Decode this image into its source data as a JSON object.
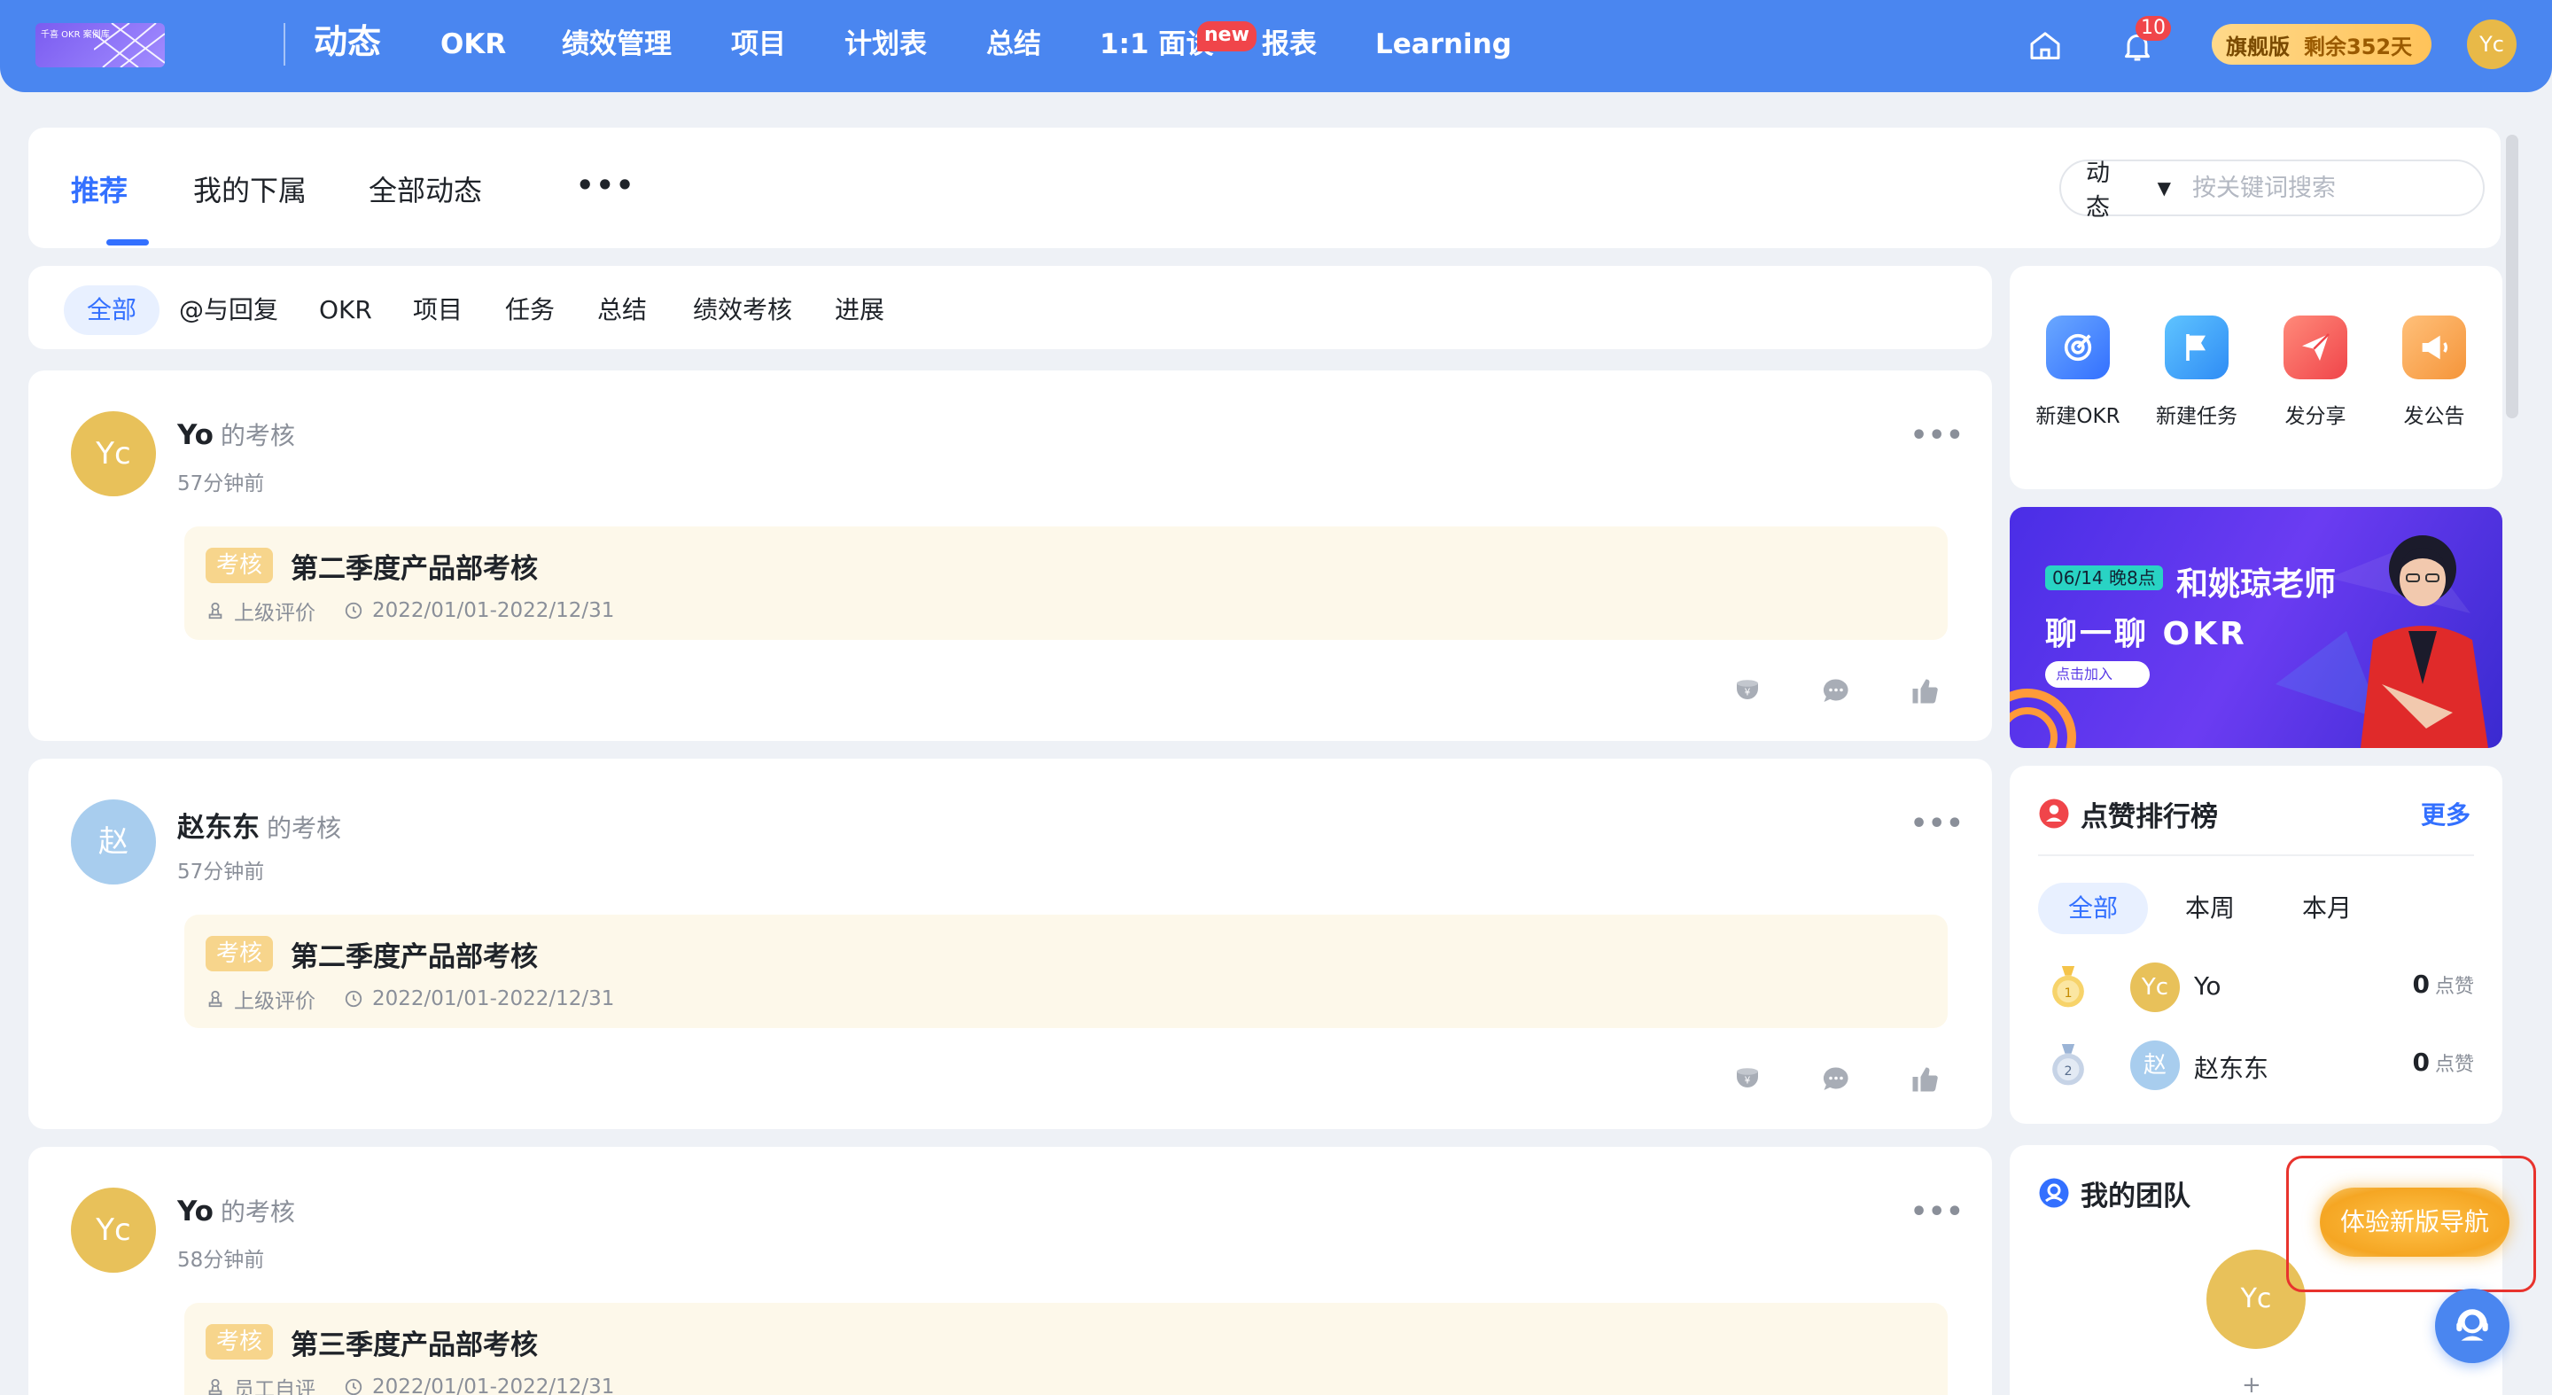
{
  "brand": {
    "logo_text": "千喜 OKR 案例库"
  },
  "nav": {
    "items": [
      "动态",
      "OKR",
      "绩效管理",
      "项目",
      "计划表",
      "总结",
      "1:1 面谈",
      "报表",
      "Learning"
    ],
    "new_badge": "new",
    "notification_count": "10",
    "plan_name": "旗舰版",
    "plan_remaining": "剩余352天",
    "avatar": "Yc"
  },
  "main_tabs": {
    "items": [
      "推荐",
      "我的下属",
      "全部动态"
    ],
    "more": "•••",
    "search_type": "动态",
    "search_placeholder": "按关键词搜索"
  },
  "filters": [
    "全部",
    "@与回复",
    "OKR",
    "项目",
    "任务",
    "总结",
    "绩效考核",
    "进展"
  ],
  "feed": [
    {
      "avatar": "Yc",
      "name": "Yo",
      "action": "的考核",
      "time": "57分钟前",
      "tag": "考核",
      "title": "第二季度产品部考核",
      "reviewer": "上级评价",
      "period": "2022/01/01-2022/12/31"
    },
    {
      "avatar": "赵",
      "name": "赵东东",
      "action": "的考核",
      "time": "57分钟前",
      "tag": "考核",
      "title": "第二季度产品部考核",
      "reviewer": "上级评价",
      "period": "2022/01/01-2022/12/31"
    },
    {
      "avatar": "Yc",
      "name": "Yo",
      "action": "的考核",
      "time": "58分钟前",
      "tag": "考核",
      "title": "第三季度产品部考核",
      "reviewer": "员工自评",
      "period": "2022/01/01-2022/12/31"
    }
  ],
  "quick_actions": [
    "新建OKR",
    "新建任务",
    "发分享",
    "发公告"
  ],
  "banner": {
    "date": "06/14 晚8点",
    "line1": "和姚琼老师",
    "line2": "聊一聊 OKR",
    "join": "点击加入"
  },
  "ranking": {
    "title": "点赞排行榜",
    "more": "更多",
    "tabs": [
      "全部",
      "本周",
      "本月"
    ],
    "rows": [
      {
        "avatar": "Yc",
        "name": "Yo",
        "count": "0",
        "unit": "点赞",
        "medal": "1"
      },
      {
        "avatar": "赵",
        "name": "赵东东",
        "count": "0",
        "unit": "点赞",
        "medal": "2"
      }
    ]
  },
  "team": {
    "title": "我的团队",
    "avatar": "Yc",
    "add": "+"
  },
  "new_nav_button": "体验新版导航",
  "colors": {
    "primary": "#3370ff",
    "nav_bg": "#4a86f0",
    "gold": "#e8c15a",
    "highlight": "#e8332d"
  }
}
